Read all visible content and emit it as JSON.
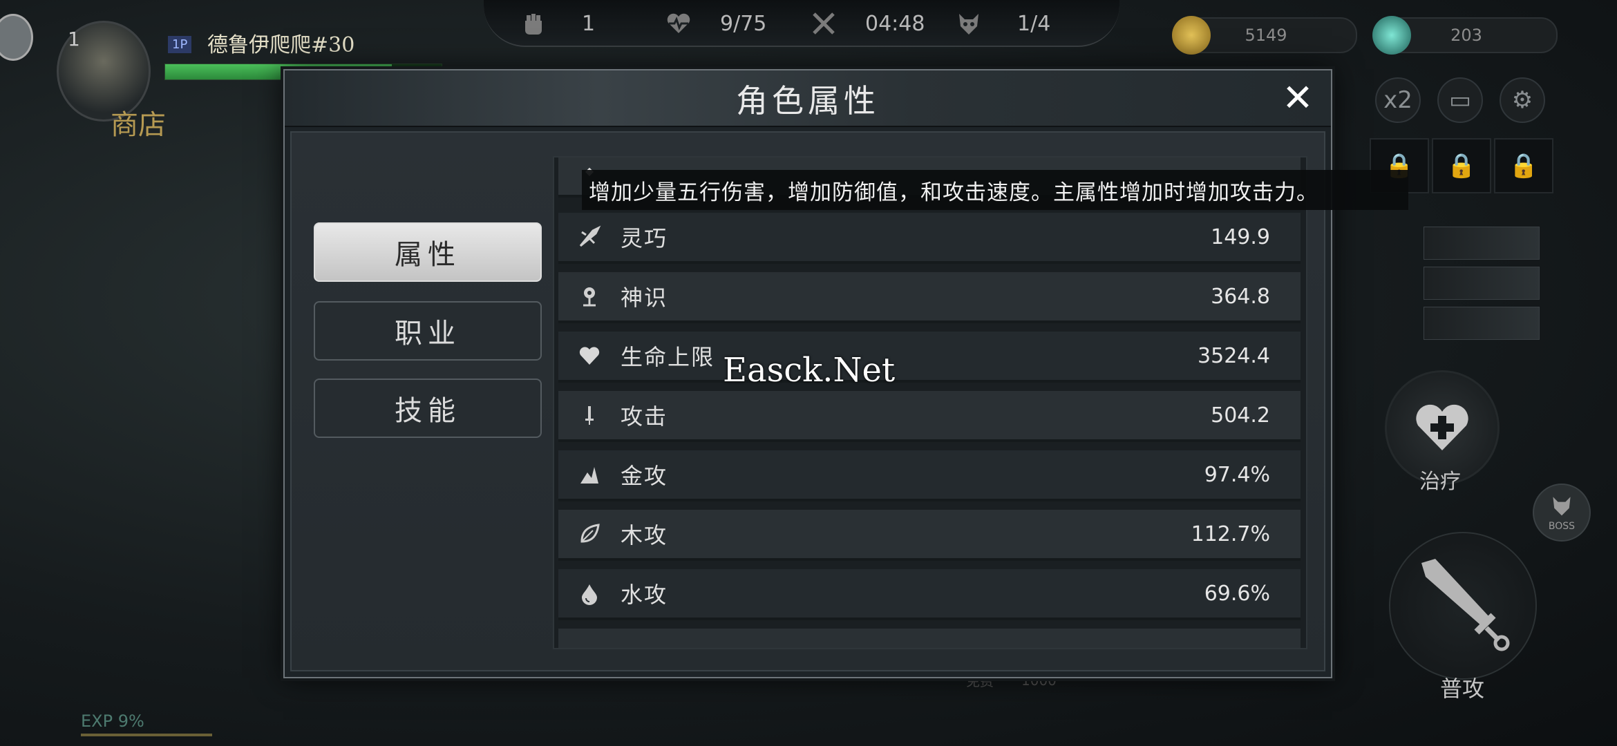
{
  "hud": {
    "stats": [
      {
        "icon": "fist-icon",
        "value": "1"
      },
      {
        "icon": "heartbeat-icon",
        "value": "9/75"
      },
      {
        "icon": "crossed-swords-icon",
        "value": "04:48"
      },
      {
        "icon": "demon-mask-icon",
        "value": "1/4"
      }
    ],
    "level": "1",
    "player_tag": "1P",
    "player_name": "德鲁伊爬爬#30",
    "hp_fraction": 0.82,
    "shop_label": "商店",
    "exp_label": "EXP 9%",
    "currencies": [
      {
        "icon": "coin-icon",
        "value": "5149",
        "color": "#b8902c"
      },
      {
        "icon": "gem-icon",
        "value": "203",
        "color": "#3fb7a6"
      }
    ],
    "speed_label": "x2",
    "heal_label": "治疗",
    "attack_label": "普攻",
    "boss_label": "BOSS",
    "cost_labels": [
      "免费",
      "1000"
    ]
  },
  "modal": {
    "title": "角色属性",
    "close": "✕",
    "tabs": [
      {
        "label": "属性",
        "active": true
      },
      {
        "label": "职业",
        "active": false
      },
      {
        "label": "技能",
        "active": false
      }
    ],
    "tooltip": "增加少量五行伤害，增加防御值，和攻击速度。主属性增加时增加攻击力。",
    "stats": [
      {
        "icon": "dexterity-icon",
        "name": "灵巧",
        "value": "149.9"
      },
      {
        "icon": "spirit-icon",
        "name": "神识",
        "value": "364.8"
      },
      {
        "icon": "heart-icon",
        "name": "生命上限",
        "value": "3524.4"
      },
      {
        "icon": "sword-icon",
        "name": "攻击",
        "value": "504.2"
      },
      {
        "icon": "metal-icon",
        "name": "金攻",
        "value": "97.4%"
      },
      {
        "icon": "leaf-icon",
        "name": "木攻",
        "value": "112.7%"
      },
      {
        "icon": "water-drop-icon",
        "name": "水攻",
        "value": "69.6%"
      }
    ]
  },
  "watermark": "Easck.Net"
}
